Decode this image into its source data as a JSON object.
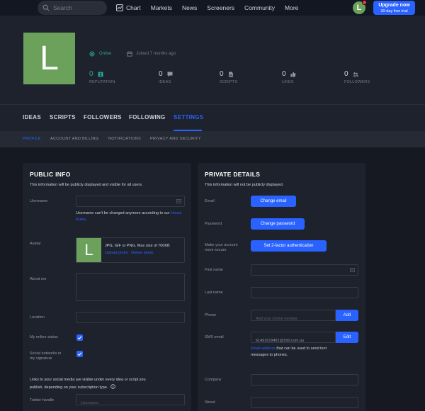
{
  "topnav": {
    "search_placeholder": "Search",
    "links": [
      "Chart",
      "Markets",
      "News",
      "Screeners",
      "Community",
      "More"
    ],
    "avatar_letter": "L",
    "upgrade_line1": "Upgrade now",
    "upgrade_line2": "30-day free trial"
  },
  "profile": {
    "avatar_letter": "L",
    "status": "Online",
    "joined": "Joined 7 months ago",
    "stats": [
      {
        "value": "0",
        "label": "REPUTATION"
      },
      {
        "value": "0",
        "label": "IDEAS"
      },
      {
        "value": "0",
        "label": "SCRIPTS"
      },
      {
        "value": "0",
        "label": "LIKES"
      },
      {
        "value": "0",
        "label": "FOLLOWERS"
      }
    ]
  },
  "tabs": [
    "IDEAS",
    "SCRIPTS",
    "FOLLOWERS",
    "FOLLOWING",
    "SETTINGS"
  ],
  "subtabs": [
    "PROFILE",
    "ACCOUNT AND BILLING",
    "NOTIFICATIONS",
    "PRIVACY AND SECURITY"
  ],
  "public_info": {
    "title": "PUBLIC INFO",
    "subtitle": "This information will be publicly displayed and visible for all users.",
    "username_label": "Username",
    "username_note_before": "Username can't be changed anymore according to our ",
    "username_note_link": "House Rules",
    "username_note_after": ".",
    "avatar_label": "Avatar",
    "avatar_letter": "L",
    "avatar_info": "JPG, GIF or PNG. Max size of 700KB",
    "upload_photo": "Upload photo",
    "delete_photo": "Delete photo",
    "about_label": "About me",
    "location_label": "Location",
    "online_status_label": "My online status",
    "social_label_1": "Social networks in",
    "social_label_2": "my signature",
    "links_note_1": "Links to your social media are visible under every idea or script you",
    "links_note_2": "publish, depending on your subscription type.",
    "twitter_label": "Twitter handle",
    "twitter_placeholder": "Username"
  },
  "private_details": {
    "title": "PRIVATE DETAILS",
    "subtitle": "This information will not be publicly displayed.",
    "email_label": "Email",
    "change_email": "Change email",
    "password_label": "Password",
    "change_password": "Change password",
    "secure_label_1": "Make your account",
    "secure_label_2": "more secure",
    "two_factor": "Set 2-factor authentication",
    "first_name_label": "First name",
    "last_name_label": "Last name",
    "phone_label": "Phone",
    "phone_placeholder": "Add your phone number",
    "add_button": "Add",
    "sms_label": "SMS email",
    "sms_value": "61491619481@160.com.au",
    "edit_button": "Edit",
    "sms_note_link": "Email address",
    "sms_note_1": " that can be used to send text",
    "sms_note_2": "messages to phones.",
    "company_label": "Company",
    "street_label": "Street"
  },
  "colors": {
    "accent": "#2962ff",
    "online": "#26a69a",
    "avatar": "#6ba15a"
  }
}
